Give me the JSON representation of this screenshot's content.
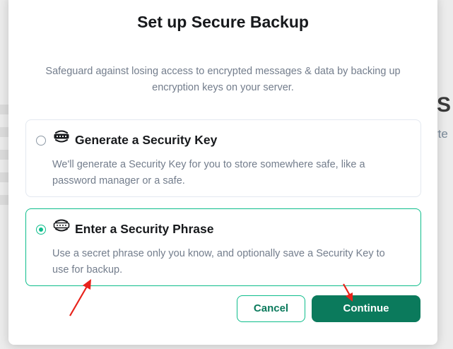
{
  "background": {
    "partial_heading": "S",
    "partial_text": "rte"
  },
  "dialog": {
    "title": "Set up Secure Backup",
    "description": "Safeguard against losing access to encrypted messages & data by backing up encryption keys on your server.",
    "options": [
      {
        "title": "Generate a Security Key",
        "description": "We'll generate a Security Key for you to store somewhere safe, like a password manager or a safe.",
        "selected": false,
        "icon": "key-icon"
      },
      {
        "title": "Enter a Security Phrase",
        "description": "Use a secret phrase only you know, and optionally save a Security Key to use for backup.",
        "selected": true,
        "icon": "phrase-icon"
      }
    ],
    "cancel_label": "Cancel",
    "continue_label": "Continue"
  },
  "colors": {
    "accent": "#0dbd8b",
    "primary_button": "#0b7a5c",
    "annotation_arrow": "#e8231b"
  }
}
